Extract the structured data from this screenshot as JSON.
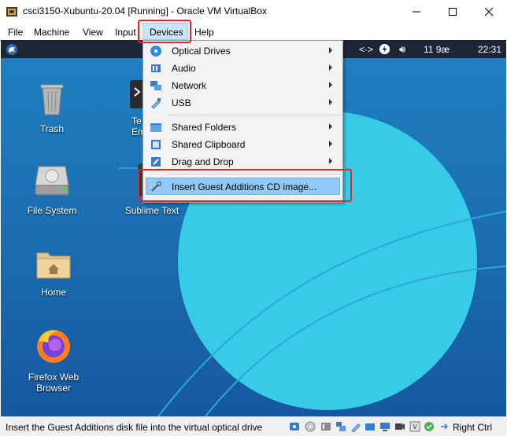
{
  "window": {
    "title": "csci3150-Xubuntu-20.04 [Running] - Oracle VM VirtualBox"
  },
  "menubar": {
    "items": [
      "File",
      "Machine",
      "View",
      "Input",
      "Devices",
      "Help"
    ],
    "active": "Devices"
  },
  "guest_panel": {
    "date": "11 9æ",
    "time": "22:31"
  },
  "desktop_icons": [
    {
      "label": "Trash"
    },
    {
      "label": "File System"
    },
    {
      "label": "Home"
    },
    {
      "label": "Firefox Web",
      "label2": "Browser"
    },
    {
      "label": "Te",
      "label2": "Em"
    },
    {
      "label": "Sublime Text"
    }
  ],
  "devices_menu": {
    "items": [
      {
        "label": "Optical Drives",
        "icon": "optical-disc-icon",
        "submenu": true
      },
      {
        "label": "Audio",
        "icon": "audio-icon",
        "submenu": true
      },
      {
        "label": "Network",
        "icon": "network-icon",
        "submenu": true
      },
      {
        "label": "USB",
        "icon": "usb-icon",
        "submenu": true
      },
      {
        "label": "Shared Folders",
        "icon": "folder-icon",
        "submenu": true
      },
      {
        "label": "Shared Clipboard",
        "icon": "clipboard-icon",
        "submenu": true
      },
      {
        "label": "Drag and Drop",
        "icon": "drag-drop-icon",
        "submenu": true
      },
      {
        "label": "Insert Guest Additions CD image...",
        "icon": "cd-insert-icon",
        "submenu": false,
        "highlighted": true
      }
    ]
  },
  "statusbar": {
    "text": "Insert the Guest Additions disk file into the virtual optical drive",
    "host_key": "Right Ctrl"
  },
  "colors": {
    "highlight_box": "#e02828",
    "menu_hover": "#91c9f7",
    "desktop_blue": "#1b6fb2",
    "panel": "#1c2637"
  }
}
